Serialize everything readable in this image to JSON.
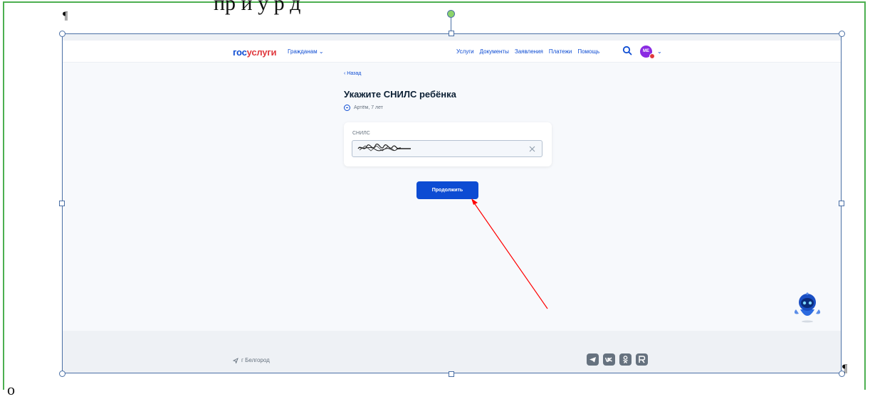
{
  "document": {
    "top_cut_text": "пр           й                          у  р д",
    "pilcrow_mark": "¶",
    "bottom_mark": "о"
  },
  "header": {
    "logo_gos": "гос",
    "logo_uslugi": "услуги",
    "citizens_menu": "Гражданам ⌄",
    "nav_items": [
      "Услуги",
      "Документы",
      "Заявления",
      "Платежи",
      "Помощь"
    ],
    "avatar_initials": "МЕ"
  },
  "main": {
    "back_label": "‹ Назад",
    "title": "Укажите СНИЛС ребёнка",
    "child_label": "Артём, 7 лет",
    "snils_label": "СНИЛС",
    "snils_value": "",
    "continue_label": "Продолжить"
  },
  "footer": {
    "city": "г Белгород",
    "socials": [
      "telegram-icon",
      "vk-icon",
      "ok-icon",
      "rutube-icon"
    ]
  },
  "colors": {
    "brand_blue": "#0d4cd3",
    "brand_red": "#e0393e",
    "arrow_red": "#ff0000",
    "selection_green": "#4caf50"
  }
}
